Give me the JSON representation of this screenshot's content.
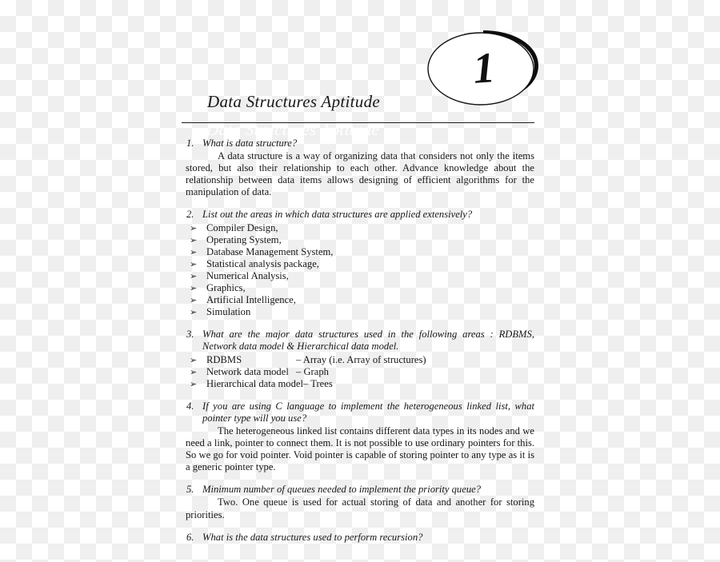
{
  "document": {
    "chapter_number": "1",
    "chapter_title": "Data Structures Aptitude",
    "ghost_title": "Data Structures Aptitude",
    "bullet_glyph": "➢"
  },
  "qa": [
    {
      "number": "1.",
      "question": "What is data structure?",
      "answer": "A data structure is a way of organizing data that considers not only the items stored, but also their relationship to each other. Advance knowledge about the relationship between data items allows designing of efficient algorithms for the manipulation of data."
    },
    {
      "number": "2.",
      "question": "List out the areas in which data structures are applied extensively?",
      "items": [
        "Compiler Design,",
        "Operating System,",
        "Database Management System,",
        "Statistical analysis package,",
        "Numerical Analysis,",
        "Graphics,",
        "Artificial Intelligence,",
        "Simulation"
      ]
    },
    {
      "number": "3.",
      "question": "What are the major data structures used in the following areas : RDBMS, Network data model & Hierarchical data model.",
      "pairs": [
        {
          "term": "RDBMS",
          "value": "– Array (i.e. Array of structures)"
        },
        {
          "term": "Network data model",
          "value": "– Graph"
        },
        {
          "term": "Hierarchical data model",
          "value": "– Trees"
        }
      ]
    },
    {
      "number": "4.",
      "question": "If you are using C language to implement the heterogeneous linked list, what pointer type will you use?",
      "answer": "The heterogeneous linked list contains different data types in its nodes and we need a link, pointer to connect them. It is not possible to use ordinary pointers for this. So we go for void pointer. Void pointer is capable of storing pointer to any type as it is a generic pointer type."
    },
    {
      "number": "5.",
      "question": "Minimum number of queues needed to implement the priority queue?",
      "answer": "Two. One queue is used for actual storing of data and another for storing priorities."
    },
    {
      "number": "6.",
      "question": "What is the data structures used to perform recursion?"
    }
  ]
}
